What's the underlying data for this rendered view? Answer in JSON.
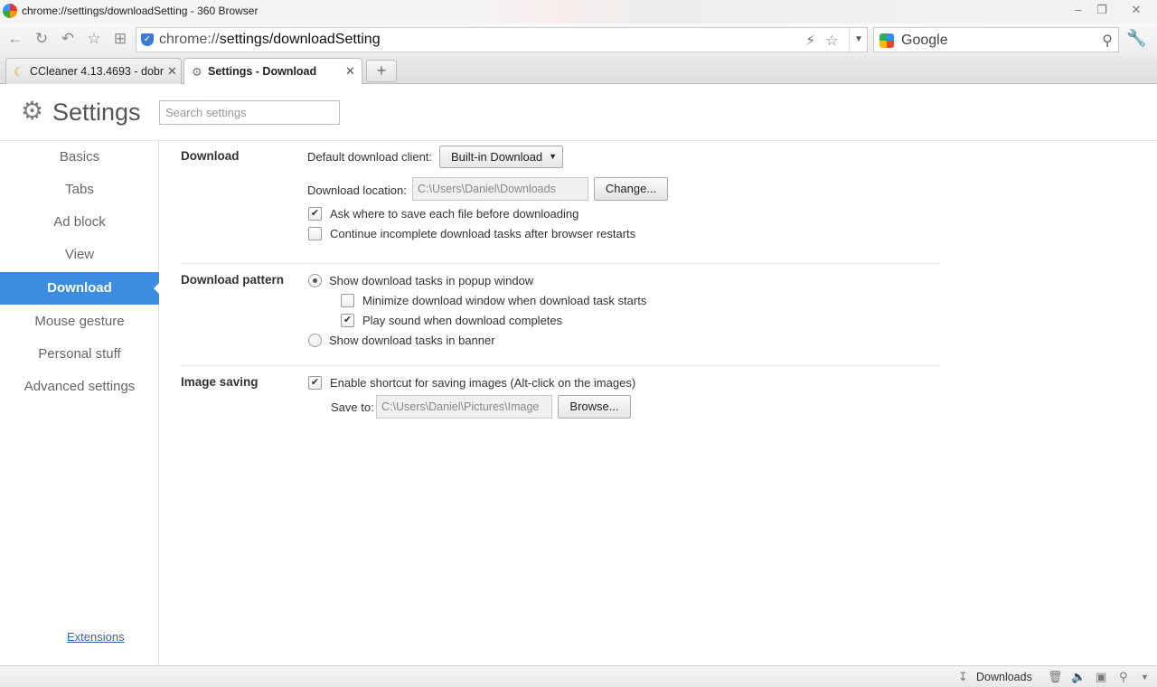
{
  "window": {
    "title": "chrome://settings/downloadSetting - 360 Browser"
  },
  "toolbar": {
    "url_prefix": "chrome://",
    "url_main": "settings/downloadSetting",
    "search_engine": "Google"
  },
  "tabs": [
    {
      "label": "CCleaner 4.13.4693 - dobr",
      "active": false
    },
    {
      "label": "Settings - Download",
      "active": true
    }
  ],
  "header": {
    "title": "Settings",
    "search_placeholder": "Search settings"
  },
  "sidebar": {
    "items": [
      {
        "label": "Basics"
      },
      {
        "label": "Tabs"
      },
      {
        "label": "Ad block"
      },
      {
        "label": "View"
      },
      {
        "label": "Download",
        "active": true
      },
      {
        "label": "Mouse gesture"
      },
      {
        "label": "Personal stuff"
      },
      {
        "label": "Advanced settings"
      }
    ],
    "extensions_link": "Extensions"
  },
  "download": {
    "section_title": "Download",
    "client_label": "Default download client:",
    "client_value": "Built-in Download",
    "location_label": "Download location:",
    "location_value": "C:\\Users\\Daniel\\Downloads",
    "change_button": "Change...",
    "ask_where_label": "Ask where to save each file before downloading",
    "ask_where_checked": true,
    "continue_label": "Continue incomplete download tasks after browser restarts",
    "continue_checked": false
  },
  "pattern": {
    "section_title": "Download pattern",
    "popup_label": "Show download tasks in popup window",
    "popup_selected": true,
    "minimize_label": "Minimize download window when download task starts",
    "minimize_checked": false,
    "sound_label": "Play sound when download completes",
    "sound_checked": true,
    "banner_label": "Show download tasks in banner",
    "banner_selected": false
  },
  "image_saving": {
    "section_title": "Image saving",
    "shortcut_label": "Enable shortcut for saving images (Alt-click on the images)",
    "shortcut_checked": true,
    "save_to_label": "Save to:",
    "save_to_value": "C:\\Users\\Daniel\\Pictures\\Image",
    "browse_button": "Browse..."
  },
  "statusbar": {
    "downloads_label": "Downloads"
  }
}
